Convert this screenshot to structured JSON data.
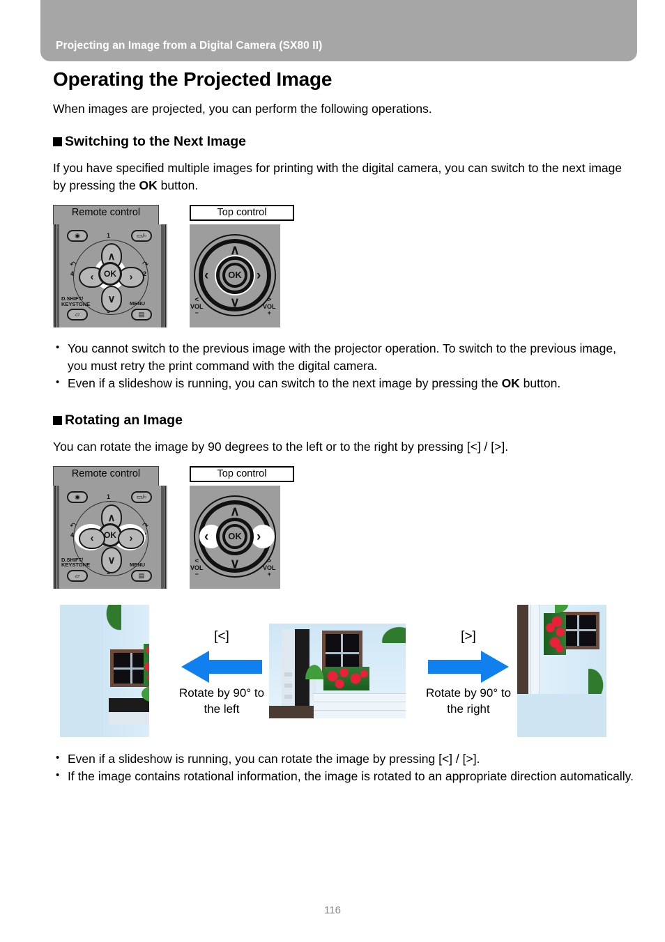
{
  "header": {
    "title": "Projecting an Image from a Digital Camera (SX80 II)"
  },
  "page": {
    "title": "Operating the Projected Image",
    "intro": "When images are projected, you can perform the following operations.",
    "number": "116"
  },
  "sections": [
    {
      "heading": "Switching to the Next Image",
      "body_before_bold": "If you have specified multiple images for printing with the digital camera, you can switch to the next image by pressing the ",
      "body_bold": "OK",
      "body_after_bold": " button.",
      "labels": {
        "remote": "Remote control",
        "top": "Top control"
      },
      "notes": [
        {
          "text_1": "You cannot switch to the previous image with the projector operation. To switch to the previous image, you must retry the print command with the digital camera.",
          "bold": "",
          "text_2": ""
        },
        {
          "text_1": "Even if a slideshow is running, you can switch to the next image by pressing the ",
          "bold": "OK",
          "text_2": " button."
        }
      ]
    },
    {
      "heading": "Rotating an Image",
      "body_before_bold": "You can rotate the image by 90 degrees to the left or to the right by pressing [<] / [>].",
      "body_bold": "",
      "body_after_bold": "",
      "labels": {
        "remote": "Remote control",
        "top": "Top control"
      },
      "notes": [
        {
          "text_1": "Even if a slideshow is running, you can rotate the image by pressing [<] / [>].",
          "bold": "",
          "text_2": ""
        },
        {
          "text_1": "If the image contains rotational information, the image is rotated to an appropriate direction automatically.",
          "bold": "",
          "text_2": ""
        }
      ]
    }
  ],
  "remote_control": {
    "ok_label": "OK",
    "numbers": {
      "n1": "1",
      "n2": "2",
      "n3": "3",
      "n4": "4"
    },
    "arc_left": "↶",
    "arc_right": "↷",
    "dshift_line1": "D.SHIFT/",
    "dshift_line2": "KEYSTONE",
    "menu_label": "MENU",
    "chevron_up": "∧",
    "chevron_down": "∨",
    "chevron_left": "‹",
    "chevron_right": "›"
  },
  "top_control": {
    "ok_label": "OK",
    "vol_left_sign": "<",
    "vol_left_text": "VOL",
    "vol_left_pm": "−",
    "vol_right_sign": ">",
    "vol_right_text": "VOL",
    "vol_right_pm": "+"
  },
  "rotation_figure": {
    "left_key": "[<]",
    "left_caption_line1": "Rotate by 90° to",
    "left_caption_line2": "the left",
    "right_key": "[>]",
    "right_caption_line1": "Rotate by 90° to",
    "right_caption_line2": "the right",
    "arrow_color": "#1080ee"
  }
}
